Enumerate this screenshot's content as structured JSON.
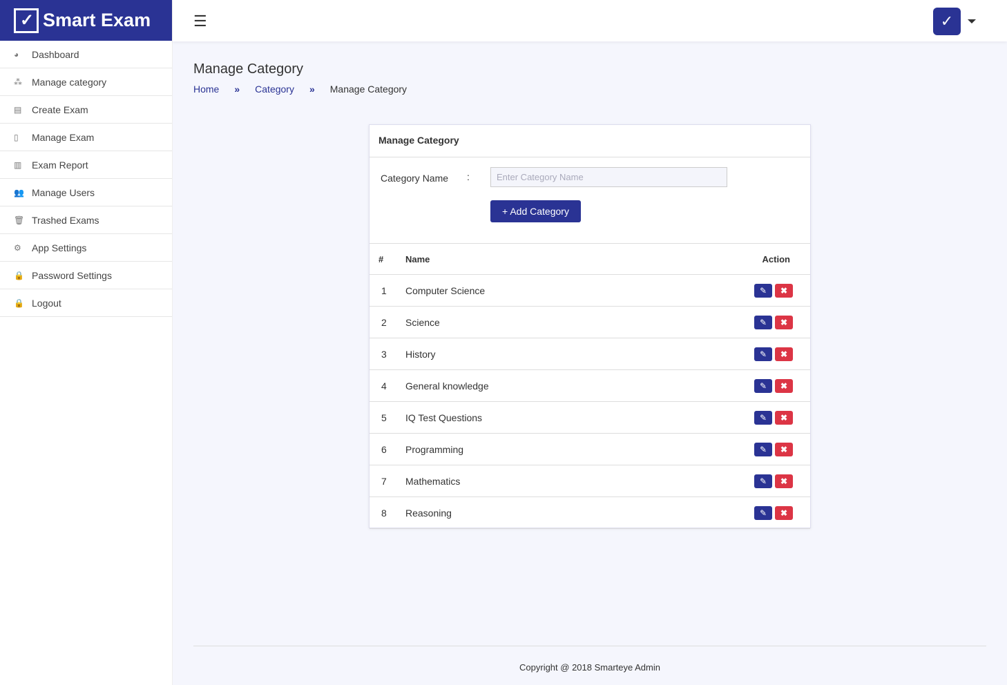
{
  "brand": {
    "name": "Smart Exam"
  },
  "sidebar": {
    "items": [
      {
        "label": "Dashboard",
        "icon": "◕"
      },
      {
        "label": "Manage category",
        "icon": "⁂"
      },
      {
        "label": "Create Exam",
        "icon": "▤"
      },
      {
        "label": "Manage Exam",
        "icon": "▯"
      },
      {
        "label": "Exam Report",
        "icon": "▥"
      },
      {
        "label": "Manage Users",
        "icon": "👥"
      },
      {
        "label": "Trashed Exams",
        "icon": "🗑"
      },
      {
        "label": "App Settings",
        "icon": "⚙"
      },
      {
        "label": "Password Settings",
        "icon": "🔒"
      },
      {
        "label": "Logout",
        "icon": "🔒"
      }
    ]
  },
  "header": {
    "menu_icon": "☰",
    "avatar_icon": "✓"
  },
  "page": {
    "title": "Manage Category",
    "breadcrumb": [
      "Home",
      "Category",
      "Manage Category"
    ],
    "sep": "»"
  },
  "card": {
    "title": "Manage Category",
    "field_label": "Category Name",
    "colon": ":",
    "placeholder": "Enter Category Name",
    "add_label": "+ Add Category",
    "columns": [
      "#",
      "Name",
      "Action"
    ],
    "rows": [
      {
        "n": "1",
        "name": "Computer Science"
      },
      {
        "n": "2",
        "name": "Science"
      },
      {
        "n": "3",
        "name": "History"
      },
      {
        "n": "4",
        "name": "General knowledge"
      },
      {
        "n": "5",
        "name": "IQ Test Questions"
      },
      {
        "n": "6",
        "name": "Programming"
      },
      {
        "n": "7",
        "name": "Mathematics"
      },
      {
        "n": "8",
        "name": "Reasoning"
      }
    ],
    "edit_icon": "✎",
    "delete_icon": "✖"
  },
  "footer": {
    "text": "Copyright @ 2018 Smarteye Admin"
  }
}
